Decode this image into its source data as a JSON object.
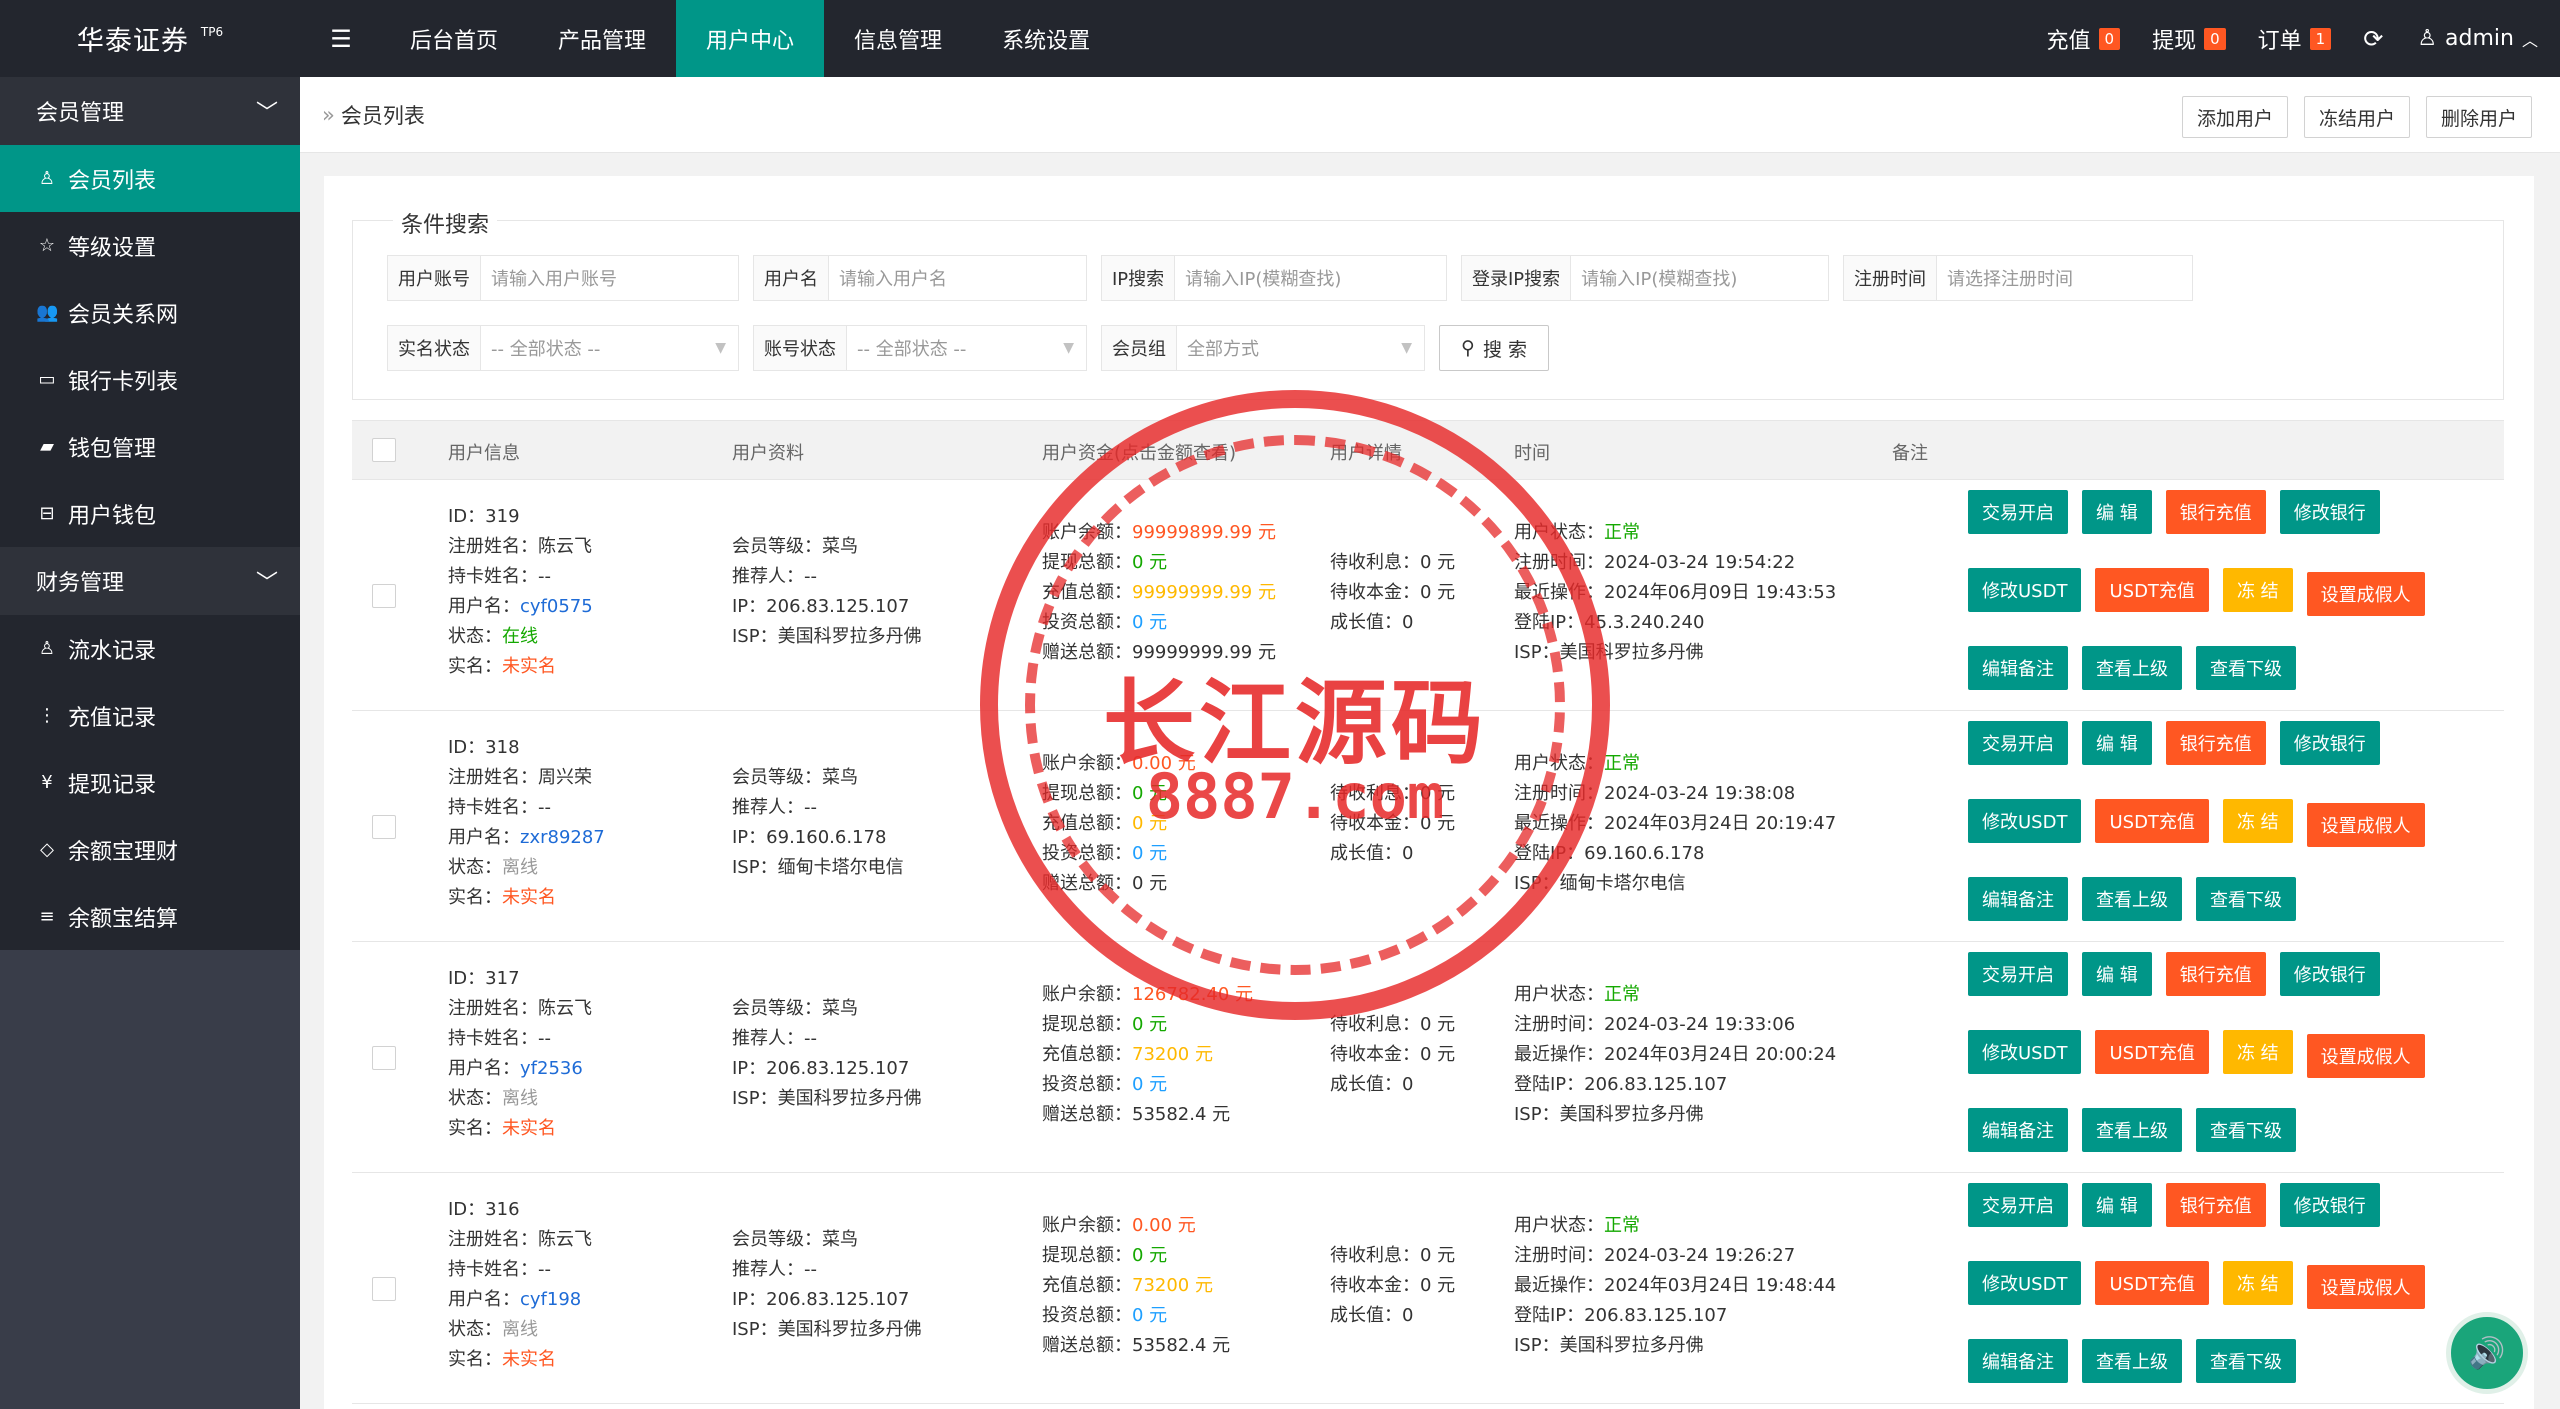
{
  "header": {
    "logo_name": "华泰证券",
    "logo_sup": "TP6",
    "menu_icon": "hamburger-icon",
    "nav": [
      "后台首页",
      "产品管理",
      "用户中心",
      "信息管理",
      "系统设置"
    ],
    "active_nav": "用户中心",
    "recharge_label": "充值",
    "recharge_count": "0",
    "withdraw_label": "提现",
    "withdraw_count": "0",
    "order_label": "订单",
    "order_count": "1",
    "user_label": "admin"
  },
  "sidebar": {
    "group1": "会员管理",
    "items1": [
      "会员列表",
      "等级设置",
      "会员关系网",
      "银行卡列表",
      "钱包管理",
      "用户钱包"
    ],
    "group2": "财务管理",
    "items2": [
      "流水记录",
      "充值记录",
      "提现记录",
      "余额宝理财",
      "余额宝结算"
    ]
  },
  "breadcrumb": {
    "text": "会员列表"
  },
  "actions": {
    "add": "添加用户",
    "freeze": "冻结用户",
    "delete": "删除用户"
  },
  "search": {
    "legend": "条件搜索",
    "fields": [
      {
        "label": "用户账号",
        "placeholder": "请输入用户账号"
      },
      {
        "label": "用户名",
        "placeholder": "请输入用户名"
      },
      {
        "label": "IP搜索",
        "placeholder": "请输入IP(模糊查找)"
      },
      {
        "label": "登录IP搜索",
        "placeholder": "请输入IP(模糊查找)"
      },
      {
        "label": "注册时间",
        "placeholder": "请选择注册时间"
      }
    ],
    "selects": [
      {
        "label": "实名状态",
        "value": "-- 全部状态 --"
      },
      {
        "label": "账号状态",
        "value": "-- 全部状态 --"
      },
      {
        "label": "会员组",
        "value": "全部方式"
      }
    ],
    "button": "搜 索"
  },
  "table": {
    "headers": [
      "用户信息",
      "用户资料",
      "用户资金(点击金额查看)",
      "用户详情",
      "时间",
      "备注"
    ],
    "op_buttons": {
      "row1": [
        "交易开启",
        "编 辑",
        "银行充值",
        "修改银行"
      ],
      "row2": [
        "修改USDT",
        "USDT充值",
        "冻 结",
        "设置成假人"
      ],
      "row3": [
        "编辑备注",
        "查看上级",
        "查看下级"
      ]
    },
    "rows": [
      {
        "id": "ID：319",
        "reg_name": "注册姓名：陈云飞",
        "card_name": "持卡姓名：--",
        "username_label": "用户名：",
        "username": "cyf0575",
        "status_label": "状态：",
        "status": "在线",
        "real_label": "实名：",
        "real": "未实名",
        "level": "会员等级：菜鸟",
        "referrer": "推荐人：--",
        "ip": "IP：206.83.125.107",
        "isp": "ISP：美国科罗拉多丹佛",
        "balance_label": "账户余额：",
        "balance": "99999899.99 元",
        "withdraw_label": "提现总额：",
        "withdraw": "0 元",
        "recharge_label": "充值总额：",
        "recharge": "99999999.99 元",
        "invest_label": "投资总额：",
        "invest": "0 元",
        "gift_label": "赠送总额：",
        "gift": "99999999.99 元",
        "interest": "待收利息：0 元",
        "principal": "待收本金：0 元",
        "growth": "成长值：0",
        "ustatus_label": "用户状态：",
        "ustatus": "正常",
        "reg_time": "注册时间：2024-03-24 19:54:22",
        "last_op": "最近操作：2024年06月09日 19:43:53",
        "login_ip": "登陆IP：45.3.240.240",
        "login_isp": "ISP：美国科罗拉多丹佛"
      },
      {
        "id": "ID：318",
        "reg_name": "注册姓名：周兴荣",
        "card_name": "持卡姓名：--",
        "username_label": "用户名：",
        "username": "zxr89287",
        "status_label": "状态：",
        "status": "离线",
        "real_label": "实名：",
        "real": "未实名",
        "level": "会员等级：菜鸟",
        "referrer": "推荐人：--",
        "ip": "IP：69.160.6.178",
        "isp": "ISP：缅甸卡塔尔电信",
        "balance_label": "账户余额：",
        "balance": "0.00 元",
        "withdraw_label": "提现总额：",
        "withdraw": "0 元",
        "recharge_label": "充值总额：",
        "recharge": "0 元",
        "invest_label": "投资总额：",
        "invest": "0 元",
        "gift_label": "赠送总额：",
        "gift": "0 元",
        "interest": "待收利息：0 元",
        "principal": "待收本金：0 元",
        "growth": "成长值：0",
        "ustatus_label": "用户状态：",
        "ustatus": "正常",
        "reg_time": "注册时间：2024-03-24 19:38:08",
        "last_op": "最近操作：2024年03月24日 20:19:47",
        "login_ip": "登陆IP：69.160.6.178",
        "login_isp": "ISP：缅甸卡塔尔电信"
      },
      {
        "id": "ID：317",
        "reg_name": "注册姓名：陈云飞",
        "card_name": "持卡姓名：--",
        "username_label": "用户名：",
        "username": "yf2536",
        "status_label": "状态：",
        "status": "离线",
        "real_label": "实名：",
        "real": "未实名",
        "level": "会员等级：菜鸟",
        "referrer": "推荐人：--",
        "ip": "IP：206.83.125.107",
        "isp": "ISP：美国科罗拉多丹佛",
        "balance_label": "账户余额：",
        "balance": "126782.40 元",
        "withdraw_label": "提现总额：",
        "withdraw": "0 元",
        "recharge_label": "充值总额：",
        "recharge": "73200 元",
        "invest_label": "投资总额：",
        "invest": "0 元",
        "gift_label": "赠送总额：",
        "gift": "53582.4 元",
        "interest": "待收利息：0 元",
        "principal": "待收本金：0 元",
        "growth": "成长值：0",
        "ustatus_label": "用户状态：",
        "ustatus": "正常",
        "reg_time": "注册时间：2024-03-24 19:33:06",
        "last_op": "最近操作：2024年03月24日 20:00:24",
        "login_ip": "登陆IP：206.83.125.107",
        "login_isp": "ISP：美国科罗拉多丹佛"
      },
      {
        "id": "ID：316",
        "reg_name": "注册姓名：陈云飞",
        "card_name": "持卡姓名：--",
        "username_label": "用户名：",
        "username": "cyf198",
        "status_label": "状态：",
        "status": "离线",
        "real_label": "实名：",
        "real": "未实名",
        "level": "会员等级：菜鸟",
        "referrer": "推荐人：--",
        "ip": "IP：206.83.125.107",
        "isp": "ISP：美国科罗拉多丹佛",
        "balance_label": "账户余额：",
        "balance": "0.00 元",
        "withdraw_label": "提现总额：",
        "withdraw": "0 元",
        "recharge_label": "充值总额：",
        "recharge": "73200 元",
        "invest_label": "投资总额：",
        "invest": "0 元",
        "gift_label": "赠送总额：",
        "gift": "53582.4 元",
        "interest": "待收利息：0 元",
        "principal": "待收本金：0 元",
        "growth": "成长值：0",
        "ustatus_label": "用户状态：",
        "ustatus": "正常",
        "reg_time": "注册时间：2024-03-24 19:26:27",
        "last_op": "最近操作：2024年03月24日 19:48:44",
        "login_ip": "登陆IP：206.83.125.107",
        "login_isp": "ISP：美国科罗拉多丹佛"
      }
    ]
  },
  "watermark": {
    "text": "长江源码",
    "url": "8887.com"
  },
  "colors": {
    "accent": "#009688",
    "danger": "#ff5722",
    "warn": "#ffb800",
    "info": "#1e9fff",
    "dark": "#23262e"
  }
}
